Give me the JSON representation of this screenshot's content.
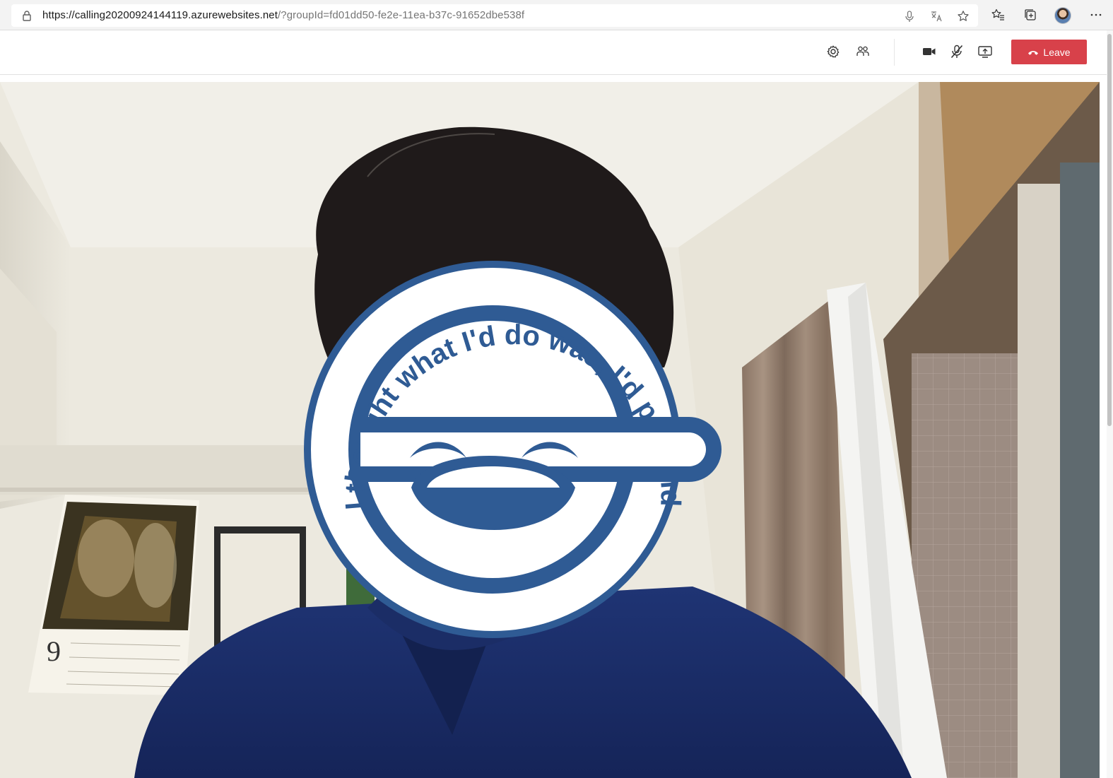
{
  "browser": {
    "url": {
      "host_part": "https://calling20200924144119.azurewebsites.net",
      "query_part": "/?groupId=fd01dd50-fe2e-11ea-b37c-91652dbe538f"
    },
    "address_icons": [
      "mic-icon",
      "translate-icon",
      "favorite-star-icon"
    ],
    "toolbar_icons": [
      "favorites-icon",
      "collections-icon",
      "profile-avatar",
      "more-icon"
    ]
  },
  "call_toolbar": {
    "icons": [
      "settings-icon",
      "participants-icon",
      "camera-icon",
      "mic-muted-icon",
      "share-screen-icon"
    ],
    "leave_label": "Leave",
    "leave_color": "#d8414a"
  },
  "video": {
    "emblem_text": "I thought what I'd do was, I'd pretend I was one of those deaf-mutes",
    "emblem_color": "#2f5b94",
    "calendar_month": "9"
  }
}
